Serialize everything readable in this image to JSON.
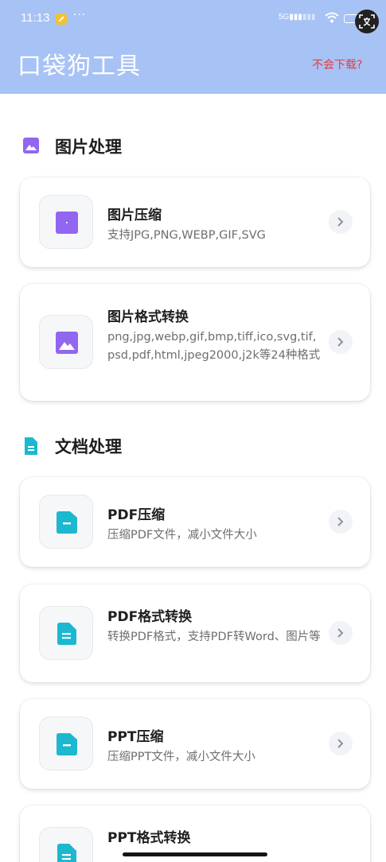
{
  "status_bar": {
    "time": "11:13",
    "dots": "···",
    "signal_primary": "5G",
    "signal_secondary": "..."
  },
  "header": {
    "title": "口袋狗工具",
    "help_link": "不会下载?"
  },
  "sections": [
    {
      "title": "图片处理",
      "icon": "image-icon",
      "color": "#9266f0",
      "items": [
        {
          "title": "图片压缩",
          "desc": "支持JPG,PNG,WEBP,GIF,SVG",
          "icon": "square-dot-icon"
        },
        {
          "title": "图片格式转换",
          "desc": "png,jpg,webp,gif,bmp,tiff,ico,svg,tif,psd,pdf,html,jpeg2000,j2k等24种格式",
          "icon": "picture-icon"
        }
      ]
    },
    {
      "title": "文档处理",
      "icon": "document-icon",
      "color": "#1cb8cf",
      "items": [
        {
          "title": "PDF压缩",
          "desc": "压缩PDF文件，减小文件大小",
          "icon": "folder-minus-icon"
        },
        {
          "title": "PDF格式转换",
          "desc": "转换PDF格式，支持PDF转Word、图片等",
          "icon": "file-text-icon"
        },
        {
          "title": "PPT压缩",
          "desc": "压缩PPT文件，减小文件大小",
          "icon": "folder-minus-icon"
        },
        {
          "title": "PPT格式转换",
          "desc": "",
          "icon": "file-text-icon"
        }
      ]
    }
  ],
  "colors": {
    "header_bg": "#a7c2f5",
    "help_link": "#e43d3d",
    "image_accent": "#9266f0",
    "doc_accent": "#1cb8cf"
  }
}
